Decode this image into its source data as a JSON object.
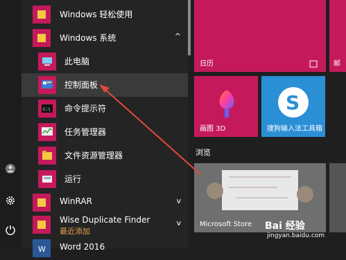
{
  "start_list": {
    "items": [
      {
        "label": "Windows 轻松使用",
        "icon": "folder-icon"
      },
      {
        "label": "Windows 系统",
        "icon": "folder-icon",
        "expanded_glyph": "^"
      },
      {
        "label": "此电脑",
        "icon": "computer-icon"
      },
      {
        "label": "控制面板",
        "icon": "control-panel-icon"
      },
      {
        "label": "命令提示符",
        "icon": "cmd-icon"
      },
      {
        "label": "任务管理器",
        "icon": "task-manager-icon"
      },
      {
        "label": "文件资源管理器",
        "icon": "explorer-icon"
      },
      {
        "label": "运行",
        "icon": "run-icon"
      },
      {
        "label": "WinRAR",
        "icon": "folder-icon",
        "expanded_glyph": "v"
      },
      {
        "label": "Wise Duplicate Finder",
        "sublabel": "最近添加",
        "icon": "app-icon",
        "expanded_glyph": "v"
      },
      {
        "label": "Word 2016",
        "icon": "word-icon"
      }
    ]
  },
  "tiles": {
    "calendar": {
      "label": "日历"
    },
    "mail": {
      "label": "邮"
    },
    "paint3d": {
      "label": "画图 3D"
    },
    "sogou": {
      "label": "搜狗输入法工具箱"
    },
    "section_browse": "浏览",
    "store": {
      "label": "Microsoft Store"
    }
  },
  "watermark": {
    "text": "Bai 经验",
    "sub": "jingyan.baidu.com"
  },
  "colors": {
    "accent": "#c41a5b",
    "sogou": "#2b8fd6",
    "selected": "#3a3a3a"
  }
}
